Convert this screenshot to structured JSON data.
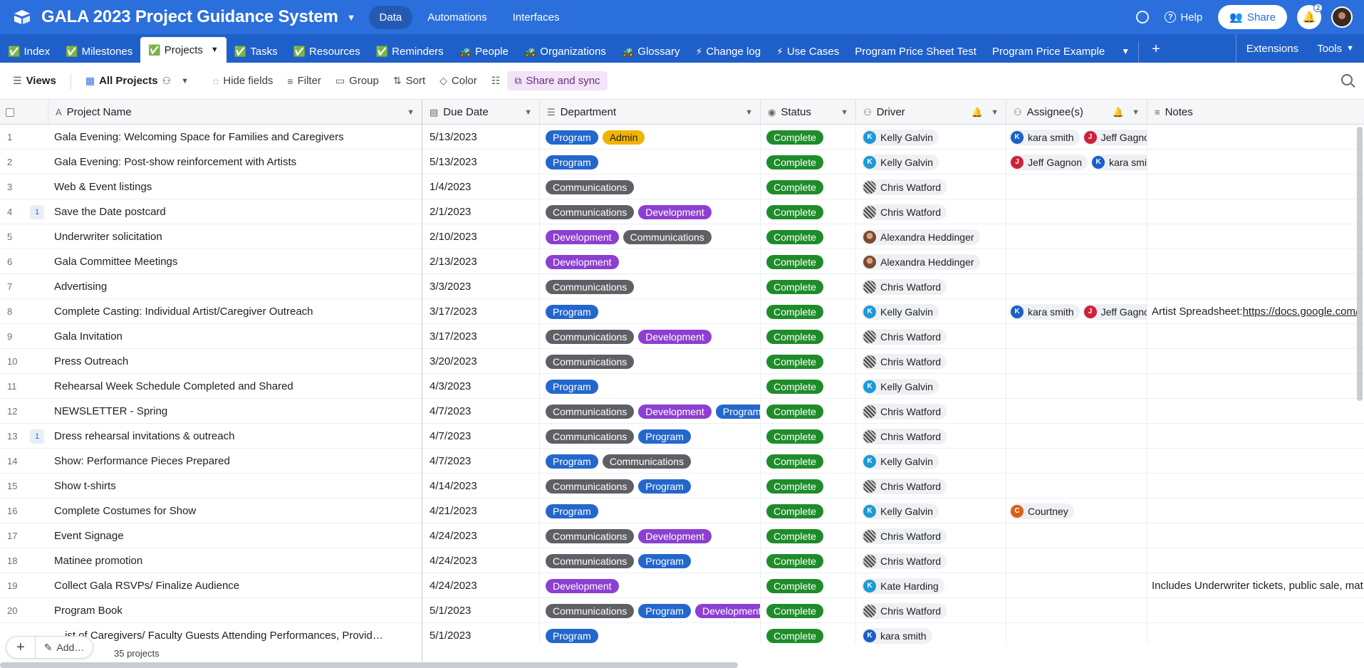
{
  "app": {
    "title": "GALA 2023 Project Guidance System",
    "nav": [
      "Data",
      "Automations",
      "Interfaces"
    ],
    "active_nav": "Data",
    "help": "Help",
    "share": "Share",
    "notifications": "2"
  },
  "tabs": [
    {
      "label": "Index",
      "emoji": "✅"
    },
    {
      "label": "Milestones",
      "emoji": "✅"
    },
    {
      "label": "Projects",
      "emoji": "✅",
      "active": true
    },
    {
      "label": "Tasks",
      "emoji": "✅"
    },
    {
      "label": "Resources",
      "emoji": "✅"
    },
    {
      "label": "Reminders",
      "emoji": "✅"
    },
    {
      "label": "People",
      "emoji": "🚜"
    },
    {
      "label": "Organizations",
      "emoji": "🚜"
    },
    {
      "label": "Glossary",
      "emoji": "🚜"
    },
    {
      "label": "Change log",
      "emoji": "⚡"
    },
    {
      "label": "Use Cases",
      "emoji": "⚡"
    },
    {
      "label": "Program Price Sheet Test",
      "emoji": ""
    },
    {
      "label": "Program Price Example",
      "emoji": ""
    }
  ],
  "tabs_right": [
    "Extensions",
    "Tools"
  ],
  "toolbar": {
    "views": "Views",
    "view_name": "All Projects",
    "hide_fields": "Hide fields",
    "filter": "Filter",
    "group": "Group",
    "sort": "Sort",
    "color": "Color",
    "share_sync": "Share and sync"
  },
  "columns": {
    "name": "Project Name",
    "due": "Due Date",
    "dept": "Department",
    "status": "Status",
    "driver": "Driver",
    "assignees": "Assignee(s)",
    "notes": "Notes"
  },
  "rows": [
    {
      "n": "1",
      "c": "",
      "name": "Gala Evening: Welcoming Space for Families and Caregivers",
      "due": "5/13/2023",
      "dept": [
        "Program",
        "Admin"
      ],
      "status": "Complete",
      "driver": "Kelly Galvin",
      "dav": "K",
      "dcls": "av-k",
      "assg": [
        {
          "name": "kara smith",
          "i": "K",
          "cls": "av-kara"
        },
        {
          "name": "Jeff Gagnon",
          "i": "J",
          "cls": "av-j"
        }
      ],
      "notes": "",
      "link": ""
    },
    {
      "n": "2",
      "c": "",
      "name": "Gala Evening: Post-show reinforcement with Artists",
      "due": "5/13/2023",
      "dept": [
        "Program"
      ],
      "status": "Complete",
      "driver": "Kelly Galvin",
      "dav": "K",
      "dcls": "av-k",
      "assg": [
        {
          "name": "Jeff Gagnon",
          "i": "J",
          "cls": "av-j"
        },
        {
          "name": "kara smith",
          "i": "K",
          "cls": "av-kara"
        }
      ],
      "notes": "",
      "link": ""
    },
    {
      "n": "3",
      "c": "",
      "name": "Web & Event listings",
      "due": "1/4/2023",
      "dept": [
        "Communications"
      ],
      "status": "Complete",
      "driver": "Chris Watford",
      "dav": "",
      "dcls": "av-chris",
      "assg": [],
      "notes": "",
      "link": ""
    },
    {
      "n": "4",
      "c": "1",
      "name": "Save the Date postcard",
      "due": "2/1/2023",
      "dept": [
        "Communications",
        "Development"
      ],
      "status": "Complete",
      "driver": "Chris Watford",
      "dav": "",
      "dcls": "av-chris",
      "assg": [],
      "notes": "",
      "link": ""
    },
    {
      "n": "5",
      "c": "",
      "name": "Underwriter solicitation",
      "due": "2/10/2023",
      "dept": [
        "Development",
        "Communications"
      ],
      "status": "Complete",
      "driver": "Alexandra Heddinger",
      "dav": "",
      "dcls": "av-alex",
      "assg": [],
      "notes": "",
      "link": ""
    },
    {
      "n": "6",
      "c": "",
      "name": "Gala Committee Meetings",
      "due": "2/13/2023",
      "dept": [
        "Development"
      ],
      "status": "Complete",
      "driver": "Alexandra Heddinger",
      "dav": "",
      "dcls": "av-alex",
      "assg": [],
      "notes": "",
      "link": ""
    },
    {
      "n": "7",
      "c": "",
      "name": "Advertising",
      "due": "3/3/2023",
      "dept": [
        "Communications"
      ],
      "status": "Complete",
      "driver": "Chris Watford",
      "dav": "",
      "dcls": "av-chris",
      "assg": [],
      "notes": "",
      "link": ""
    },
    {
      "n": "8",
      "c": "",
      "name": "Complete Casting: Individual Artist/Caregiver Outreach",
      "due": "3/17/2023",
      "dept": [
        "Program"
      ],
      "status": "Complete",
      "driver": "Kelly Galvin",
      "dav": "K",
      "dcls": "av-k",
      "assg": [
        {
          "name": "kara smith",
          "i": "K",
          "cls": "av-kara"
        },
        {
          "name": "Jeff Gagnon",
          "i": "J",
          "cls": "av-j"
        }
      ],
      "notes": "Artist Spreadsheet: ",
      "link": "https://docs.google.com/"
    },
    {
      "n": "9",
      "c": "",
      "name": "Gala Invitation",
      "due": "3/17/2023",
      "dept": [
        "Communications",
        "Development"
      ],
      "status": "Complete",
      "driver": "Chris Watford",
      "dav": "",
      "dcls": "av-chris",
      "assg": [],
      "notes": "",
      "link": ""
    },
    {
      "n": "10",
      "c": "",
      "name": "Press Outreach",
      "due": "3/20/2023",
      "dept": [
        "Communications"
      ],
      "status": "Complete",
      "driver": "Chris Watford",
      "dav": "",
      "dcls": "av-chris",
      "assg": [],
      "notes": "",
      "link": ""
    },
    {
      "n": "11",
      "c": "",
      "name": "Rehearsal Week Schedule Completed and Shared",
      "due": "4/3/2023",
      "dept": [
        "Program"
      ],
      "status": "Complete",
      "driver": "Kelly Galvin",
      "dav": "K",
      "dcls": "av-k",
      "assg": [],
      "notes": "",
      "link": ""
    },
    {
      "n": "12",
      "c": "",
      "name": "NEWSLETTER - Spring",
      "due": "4/7/2023",
      "dept": [
        "Communications",
        "Development",
        "Program"
      ],
      "status": "Complete",
      "driver": "Chris Watford",
      "dav": "",
      "dcls": "av-chris",
      "assg": [],
      "notes": "",
      "link": ""
    },
    {
      "n": "13",
      "c": "1",
      "name": "Dress rehearsal invitations & outreach",
      "due": "4/7/2023",
      "dept": [
        "Communications",
        "Program"
      ],
      "status": "Complete",
      "driver": "Chris Watford",
      "dav": "",
      "dcls": "av-chris",
      "assg": [],
      "notes": "",
      "link": ""
    },
    {
      "n": "14",
      "c": "",
      "name": "Show: Performance Pieces Prepared",
      "due": "4/7/2023",
      "dept": [
        "Program",
        "Communications"
      ],
      "status": "Complete",
      "driver": "Kelly Galvin",
      "dav": "K",
      "dcls": "av-k",
      "assg": [],
      "notes": "",
      "link": ""
    },
    {
      "n": "15",
      "c": "",
      "name": "Show t-shirts",
      "due": "4/14/2023",
      "dept": [
        "Communications",
        "Program"
      ],
      "status": "Complete",
      "driver": "Chris Watford",
      "dav": "",
      "dcls": "av-chris",
      "assg": [],
      "notes": "",
      "link": ""
    },
    {
      "n": "16",
      "c": "",
      "name": "Complete Costumes for Show",
      "due": "4/21/2023",
      "dept": [
        "Program"
      ],
      "status": "Complete",
      "driver": "Kelly Galvin",
      "dav": "K",
      "dcls": "av-k",
      "assg": [
        {
          "name": "Courtney",
          "i": "C",
          "cls": "av-c"
        }
      ],
      "notes": "",
      "link": ""
    },
    {
      "n": "17",
      "c": "",
      "name": "Event Signage",
      "due": "4/24/2023",
      "dept": [
        "Communications",
        "Development"
      ],
      "status": "Complete",
      "driver": "Chris Watford",
      "dav": "",
      "dcls": "av-chris",
      "assg": [],
      "notes": "",
      "link": ""
    },
    {
      "n": "18",
      "c": "",
      "name": "Matinee promotion",
      "due": "4/24/2023",
      "dept": [
        "Communications",
        "Program"
      ],
      "status": "Complete",
      "driver": "Chris Watford",
      "dav": "",
      "dcls": "av-chris",
      "assg": [],
      "notes": "",
      "link": ""
    },
    {
      "n": "19",
      "c": "",
      "name": "Collect Gala RSVPs/ Finalize Audience",
      "due": "4/24/2023",
      "dept": [
        "Development"
      ],
      "status": "Complete",
      "driver": "Kate Harding",
      "dav": "K",
      "dcls": "av-kate",
      "assg": [],
      "notes": "Includes Underwriter tickets, public sale, mat",
      "link": ""
    },
    {
      "n": "20",
      "c": "",
      "name": "Program Book",
      "due": "5/1/2023",
      "dept": [
        "Communications",
        "Program",
        "Development"
      ],
      "status": "Complete",
      "driver": "Chris Watford",
      "dav": "",
      "dcls": "av-chris",
      "assg": [],
      "notes": "",
      "link": ""
    },
    {
      "n": "",
      "c": "",
      "name": "…ist of Caregivers/ Faculty Guests Attending Performances, Provid…",
      "due": "5/1/2023",
      "dept": [
        "Program"
      ],
      "status": "Complete",
      "driver": "kara smith",
      "dav": "K",
      "dcls": "av-kara",
      "assg": [],
      "notes": "",
      "link": ""
    }
  ],
  "footer": {
    "add_label": "Add…",
    "count": "35 projects"
  }
}
